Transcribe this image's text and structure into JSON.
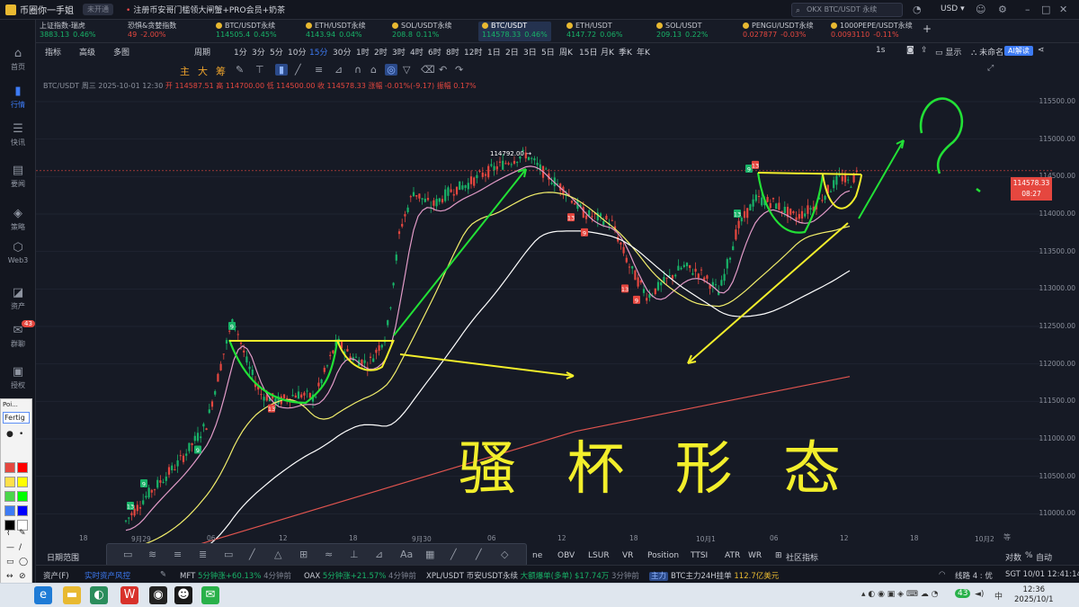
{
  "titlebar": {
    "app_name": "币圈你一手姐",
    "badge": "未开通",
    "notice": "注册币安哥门槛领大闸蟹+PRO会员+奶茶",
    "search_placeholder": "OKX BTC/USDT 永续",
    "currency": "USD ▾"
  },
  "sidebar": [
    {
      "label": "首页",
      "icon": "home-icon",
      "glyph": "⌂"
    },
    {
      "label": "行情",
      "icon": "market-icon",
      "glyph": "▮"
    },
    {
      "label": "快讯",
      "icon": "news-icon",
      "glyph": "☰"
    },
    {
      "label": "要闻",
      "icon": "headline-icon",
      "glyph": "▤"
    },
    {
      "label": "策略",
      "icon": "strategy-icon",
      "glyph": "◈"
    },
    {
      "label": "Web3",
      "icon": "web3-icon",
      "glyph": "⬡"
    },
    {
      "label": "资产",
      "icon": "asset-icon",
      "glyph": "◪"
    },
    {
      "label": "群聊",
      "icon": "chat-icon",
      "glyph": "✉",
      "badge": "43"
    },
    {
      "label": "授权",
      "icon": "auth-icon",
      "glyph": "▣"
    }
  ],
  "tickers": [
    {
      "name": "上证指数-瑞虎",
      "price": "3883.13",
      "change": "0.46%",
      "neg": false
    },
    {
      "name": "恐惧&贪婪指数",
      "price": "49",
      "change": "-2.00%",
      "neg": true
    },
    {
      "name": "BTC/USDT永续",
      "price": "114505.4",
      "change": "0.45%",
      "neg": false
    },
    {
      "name": "ETH/USDT永续",
      "price": "4143.94",
      "change": "0.04%",
      "neg": false
    },
    {
      "name": "SOL/USDT永续",
      "price": "208.8",
      "change": "0.11%",
      "neg": false
    },
    {
      "name": "BTC/USDT",
      "price": "114578.33",
      "change": "0.46%",
      "neg": false
    },
    {
      "name": "ETH/USDT",
      "price": "4147.72",
      "change": "0.06%",
      "neg": false
    },
    {
      "name": "SOL/USDT",
      "price": "209.13",
      "change": "0.22%",
      "neg": false
    },
    {
      "name": "PENGU/USDT永续",
      "price": "0.027877",
      "change": "-0.03%",
      "neg": true
    },
    {
      "name": "1000PEPE/USDT永续",
      "price": "0.0093110",
      "change": "-0.11%",
      "neg": true
    }
  ],
  "toolbar": {
    "items": [
      "指标",
      "高级",
      "多图",
      "周期",
      "1分",
      "3分",
      "5分",
      "10分",
      "15分",
      "30分",
      "1时",
      "2时",
      "3时",
      "4时",
      "6时",
      "8时",
      "12时",
      "1日",
      "2日",
      "3日",
      "5日",
      "周K",
      "15日",
      "月K",
      "季K",
      "年K"
    ],
    "selected": "15分",
    "right": [
      "1s",
      "显示",
      "未命名",
      "AI解读"
    ]
  },
  "drawtools": [
    "主",
    "大",
    "筹"
  ],
  "info": {
    "symbol": "BTC/USDT",
    "date": "周三 2025-10-01 12:30",
    "open": "开 114587.51",
    "high": "高 114700.00",
    "low": "低 114500.00",
    "close": "收 114578.33",
    "chg": "涨幅 -0.01%(-9.17)",
    "amp": "振幅 0.17%"
  },
  "chart_data": {
    "type": "candlestick",
    "y_ticks": [
      "115500.00",
      "115000.00",
      "114500.00",
      "114000.00",
      "113500.00",
      "113000.00",
      "112500.00",
      "112000.00",
      "111500.00",
      "111000.00",
      "110500.00",
      "110000.00"
    ],
    "current_price": "114578.33",
    "countdown": "08:27",
    "peak_label": "114792.00",
    "x_ticks": [
      "18",
      "9月29",
      "06",
      "12",
      "18",
      "9月30",
      "06",
      "12",
      "18",
      "10月1",
      "06",
      "12",
      "18",
      "10月2"
    ],
    "td_markers": [
      "9",
      "13",
      "9",
      "9",
      "13",
      "13",
      "9",
      "13",
      "9",
      "13",
      "9",
      "13"
    ],
    "handwriting": "骚 杯 形 态"
  },
  "indicators": [
    "ne",
    "OBV",
    "LSUR",
    "VR",
    "Position",
    "TTSI",
    "ATR",
    "WR",
    "社区指标"
  ],
  "date_range": "日期范围",
  "axis_right": [
    "对数",
    "%",
    "自动"
  ],
  "axis_corner": "等",
  "paint": {
    "title": "Poi...",
    "font": "Fertig"
  },
  "statusbar": {
    "asset": "资产(F)",
    "risk": "实时资产风控",
    "mft": "MFT",
    "mft_chg": "5分钟涨+60.13%",
    "mft_time": "4分钟前",
    "oax": "OAX",
    "oax_chg": "5分钟涨+21.57%",
    "oax_time": "4分钟前",
    "xpl": "XPL/USDT 币安USDT永续",
    "xpl_detail": "大额爆单(多单) $17.74万",
    "xpl_time": "3分钟前",
    "tag": "主力",
    "btc": "BTC主力24H挂单",
    "btc_val": "112.7亿美元",
    "line": "线路 4 : 优",
    "clock": "SGT 10/01 12:41:14"
  },
  "taskbar": {
    "time": "12:36",
    "date": "2025/10/1",
    "lang": "中",
    "badge": "43"
  }
}
